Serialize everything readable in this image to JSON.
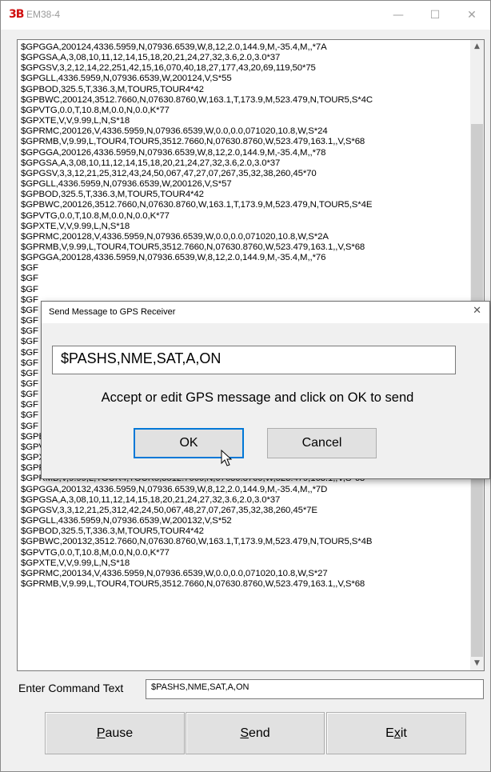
{
  "window": {
    "icon": "3B",
    "title": "EM38-4",
    "minimize_glyph": "—",
    "maximize_glyph": "☐",
    "close_glyph": "✕"
  },
  "log": {
    "lines": [
      "$GPGGA,200124,4336.5959,N,07936.6539,W,8,12,2.0,144.9,M,-35.4,M,,*7A",
      "$GPGSA,A,3,08,10,11,12,14,15,18,20,21,24,27,32,3.6,2.0,3.0*37",
      "$GPGSV,3,2,12,14,22,251,42,15,16,070,40,18,27,177,43,20,69,119,50*75",
      "$GPGLL,4336.5959,N,07936.6539,W,200124,V,S*55",
      "$GPBOD,325.5,T,336.3,M,TOUR5,TOUR4*42",
      "$GPBWC,200124,3512.7660,N,07630.8760,W,163.1,T,173.9,M,523.479,N,TOUR5,S*4C",
      "$GPVTG,0.0,T,10.8,M,0.0,N,0.0,K*77",
      "$GPXTE,V,V,9.99,L,N,S*18",
      "$GPRMC,200126,V,4336.5959,N,07936.6539,W,0.0,0.0,071020,10.8,W,S*24",
      "$GPRMB,V,9.99,L,TOUR4,TOUR5,3512.7660,N,07630.8760,W,523.479,163.1,,V,S*68",
      "$GPGGA,200126,4336.5959,N,07936.6539,W,8,12,2.0,144.9,M,-35.4,M,,*78",
      "$GPGSA,A,3,08,10,11,12,14,15,18,20,21,24,27,32,3.6,2.0,3.0*37",
      "$GPGSV,3,3,12,21,25,312,43,24,50,067,47,27,07,267,35,32,38,260,45*70",
      "$GPGLL,4336.5959,N,07936.6539,W,200126,V,S*57",
      "$GPBOD,325.5,T,336.3,M,TOUR5,TOUR4*42",
      "$GPBWC,200126,3512.7660,N,07630.8760,W,163.1,T,173.9,M,523.479,N,TOUR5,S*4E",
      "$GPVTG,0.0,T,10.8,M,0.0,N,0.0,K*77",
      "$GPXTE,V,V,9.99,L,N,S*18",
      "$GPRMC,200128,V,4336.5959,N,07936.6539,W,0.0,0.0,071020,10.8,W,S*2A",
      "$GPRMB,V,9.99,L,TOUR4,TOUR5,3512.7660,N,07630.8760,W,523.479,163.1,,V,S*68",
      "$GPGGA,200128,4336.5959,N,07936.6539,W,8,12,2.0,144.9,M,-35.4,M,,*76",
      "$GF",
      "$GF",
      "$GF",
      "$GF",
      "$GF",
      "$GF",
      "$GF",
      "$GF",
      "$GF",
      "$GF",
      "$GF",
      "$GF",
      "$GF",
      "$GF",
      "$GF",
      "$GF",
      "$GPBWC,200130,3512.7660,N,07630.8760,W,163.1,T,173.9,M,523.479,N,TOUR5,S*49",
      "$GPVTG,0.0,T,10.8,M,0.0,N,0.0,K*77",
      "$GPXTE,V,V,9.99,L,N,S*18",
      "$GPRMC,200132,V,4336.5959,N,07936.6539,W,0.0,0.0,071020,10.8,W,S*21",
      "$GPRMB,V,9.99,L,TOUR4,TOUR5,3512.7660,N,07630.8760,W,523.479,163.1,,V,S*68",
      "$GPGGA,200132,4336.5959,N,07936.6539,W,8,12,2.0,144.9,M,-35.4,M,,*7D",
      "$GPGSA,A,3,08,10,11,12,14,15,18,20,21,24,27,32,3.6,2.0,3.0*37",
      "$GPGSV,3,3,12,21,25,312,42,24,50,067,48,27,07,267,35,32,38,260,45*7E",
      "$GPGLL,4336.5959,N,07936.6539,W,200132,V,S*52",
      "$GPBOD,325.5,T,336.3,M,TOUR5,TOUR4*42",
      "$GPBWC,200132,3512.7660,N,07630.8760,W,163.1,T,173.9,M,523.479,N,TOUR5,S*4B",
      "$GPVTG,0.0,T,10.8,M,0.0,N,0.0,K*77",
      "$GPXTE,V,V,9.99,L,N,S*18",
      "$GPRMC,200134,V,4336.5959,N,07936.6539,W,0.0,0.0,071020,10.8,W,S*27",
      "$GPRMB,V,9.99,L,TOUR4,TOUR5,3512.7660,N,07630.8760,W,523.479,163.1,,V,S*68"
    ]
  },
  "scrollbar": {
    "up_glyph": "▲",
    "down_glyph": "▼"
  },
  "command": {
    "label": "Enter Command Text",
    "value": "$PASHS,NME,SAT,A,ON"
  },
  "buttons": {
    "pause": {
      "accel": "P",
      "rest": "ause"
    },
    "send": {
      "accel": "S",
      "rest": "end"
    },
    "exit": {
      "pre": "E",
      "accel": "x",
      "rest": "it"
    }
  },
  "dialog": {
    "title": "Send Message to GPS Receiver",
    "close_glyph": "✕",
    "message_value": "$PASHS,NME,SAT,A,ON",
    "prompt": "Accept or edit GPS message and click on OK to send",
    "ok_label": "OK",
    "cancel_label": "Cancel"
  }
}
